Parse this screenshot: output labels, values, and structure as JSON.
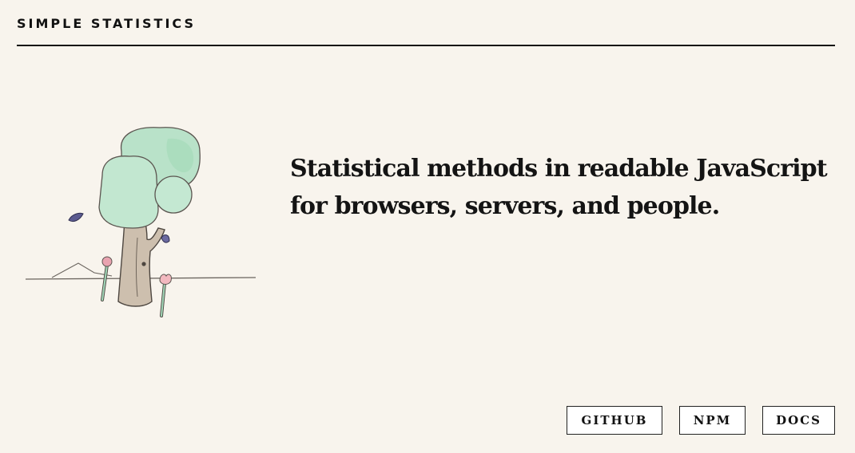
{
  "header": {
    "brand": "SIMPLE STATISTICS"
  },
  "hero": {
    "tagline_line1": "Statistical methods in readable JavaScript",
    "tagline_line2": "for browsers, servers, and people.",
    "illustration": "tree-illustration"
  },
  "nav": {
    "github_label": "GITHUB",
    "npm_label": "NPM",
    "docs_label": "DOCS"
  },
  "colors": {
    "background": "#f8f4ed",
    "text": "#141414",
    "foliage": "#b7e3c8",
    "trunk": "#c9b9a6"
  }
}
